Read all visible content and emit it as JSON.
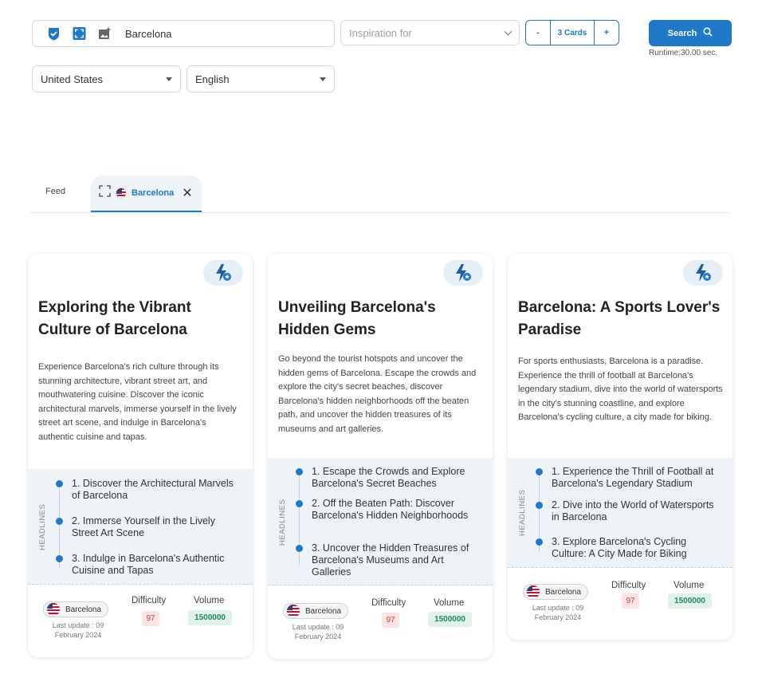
{
  "search": {
    "keyword": "Barcelona",
    "inspiration_placeholder": "Inspiration for",
    "cards_label": "3 Cards",
    "minus": "-",
    "plus": "+",
    "button_label": "Search",
    "runtime": "Runtime:30.00 sec.",
    "country": "United States",
    "language": "English"
  },
  "tabs": {
    "feed": "Feed",
    "active": "Barcelona"
  },
  "cards": [
    {
      "title": "Exploring the Vibrant Culture of Barcelona",
      "description": "Experience Barcelona's rich culture through its stunning architecture, vibrant street art, and mouthwatering cuisine. Discover the iconic architectural marvels, immerse yourself in the lively street art scene, and indulge in Barcelona's authentic cuisine and tapas.",
      "headlines_label": "HEADLINES",
      "headlines": [
        "1. Discover the Architectural Marvels of Barcelona",
        "2. Immerse Yourself in the Lively Street Art Scene",
        "3. Indulge in Barcelona's Authentic Cuisine and Tapas"
      ],
      "location": "Barcelona",
      "last_update": "Last update : 09 February 2024",
      "difficulty_label": "Difficulty",
      "difficulty": "97",
      "volume_label": "Volume",
      "volume": "1500000"
    },
    {
      "title": "Unveiling Barcelona's Hidden Gems",
      "description": "Go beyond the tourist hotspots and uncover the hidden gems of Barcelona. Escape the crowds and explore the city's secret beaches, discover Barcelona's hidden neighborhoods off the beaten path, and uncover the hidden treasures of its museums and art galleries.",
      "headlines_label": "HEADLINES",
      "headlines": [
        "1. Escape the Crowds and Explore Barcelona's Secret Beaches",
        "2. Off the Beaten Path: Discover Barcelona's Hidden Neighborhoods",
        "3. Uncover the Hidden Treasures of Barcelona's Museums and Art Galleries"
      ],
      "location": "Barcelona",
      "last_update": "Last update : 09 February 2024",
      "difficulty_label": "Difficulty",
      "difficulty": "97",
      "volume_label": "Volume",
      "volume": "1500000"
    },
    {
      "title": "Barcelona: A Sports Lover's Paradise",
      "description": "For sports enthusiasts, Barcelona is a paradise. Experience the thrill of football at Barcelona's legendary stadium, dive into the world of watersports in the city's stunning coastline, and explore Barcelona's cycling culture, a city made for biking.",
      "headlines_label": "HEADLINES",
      "headlines": [
        "1. Experience the Thrill of Football at Barcelona's Legendary Stadium",
        "2. Dive into the World of Watersports in Barcelona",
        "3. Explore Barcelona's Cycling Culture: A City Made for Biking"
      ],
      "location": "Barcelona",
      "last_update": "Last update : 09 February 2024",
      "difficulty_label": "Difficulty",
      "difficulty": "97",
      "volume_label": "Volume",
      "volume": "1500000"
    }
  ],
  "colors": {
    "accent": "#1f78c8",
    "difficulty_bg": "#fde3e3",
    "volume_bg": "#e0f2ea",
    "headlines_bg": "#eef3f8"
  }
}
